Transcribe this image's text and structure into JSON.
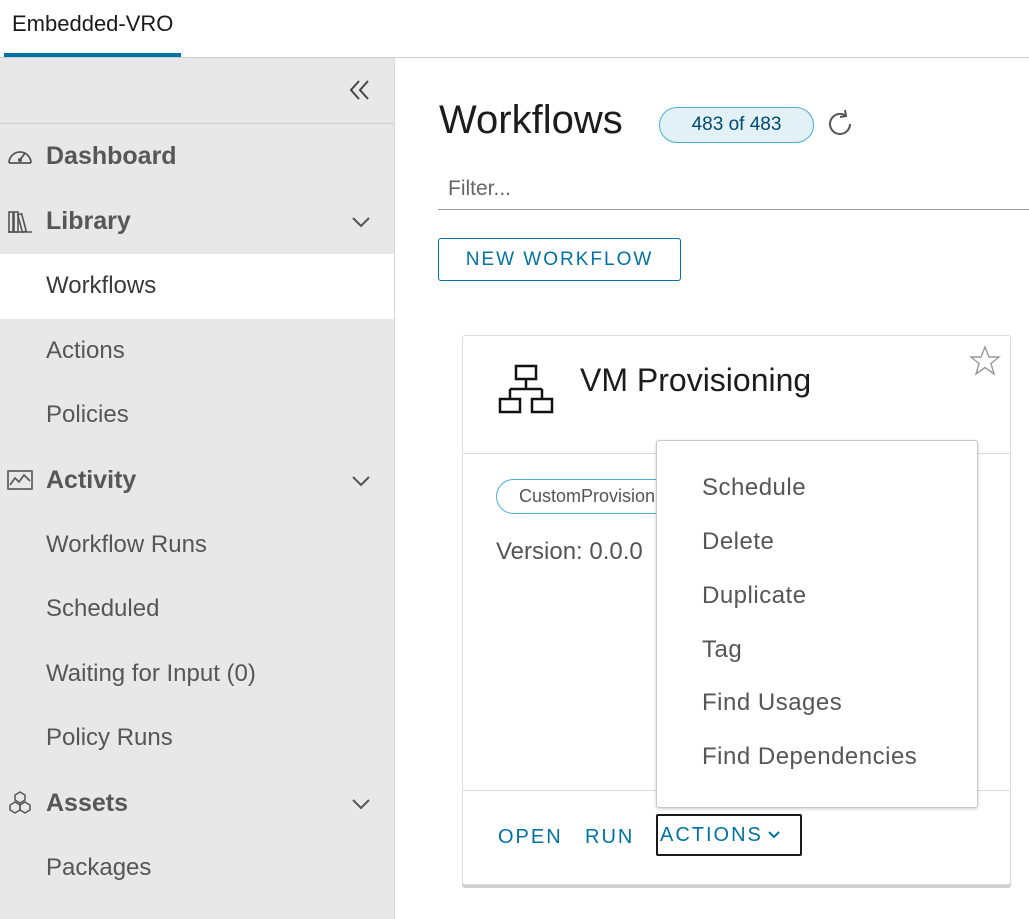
{
  "top_tab": {
    "label": "Embedded-VRO"
  },
  "sidebar": {
    "groups": [
      {
        "label": "Dashboard",
        "icon": "dashboard-icon"
      },
      {
        "label": "Library",
        "icon": "library-icon",
        "items": [
          "Workflows",
          "Actions",
          "Policies"
        ]
      },
      {
        "label": "Activity",
        "icon": "activity-icon",
        "items": [
          "Workflow Runs",
          "Scheduled",
          "Waiting for Input (0)",
          "Policy Runs"
        ]
      },
      {
        "label": "Assets",
        "icon": "assets-icon",
        "items": [
          "Packages"
        ]
      }
    ],
    "active_item": "Workflows"
  },
  "main": {
    "title": "Workflows",
    "count": "483 of 483",
    "filter_placeholder": "Filter...",
    "new_button": "NEW WORKFLOW"
  },
  "card": {
    "title": "VM Provisioning",
    "tag": "CustomProvisioning",
    "version": "Version: 0.0.0",
    "buttons": {
      "open": "OPEN",
      "run": "RUN",
      "actions": "ACTIONS"
    }
  },
  "menu": {
    "items": [
      "Schedule",
      "Delete",
      "Duplicate",
      "Tag",
      "Find Usages",
      "Find Dependencies"
    ]
  },
  "colors": {
    "accent": "#0072a3",
    "badge_bg": "#e1f1f6",
    "badge_border": "#49afd9",
    "sidebar_bg": "#e8e8e8"
  }
}
